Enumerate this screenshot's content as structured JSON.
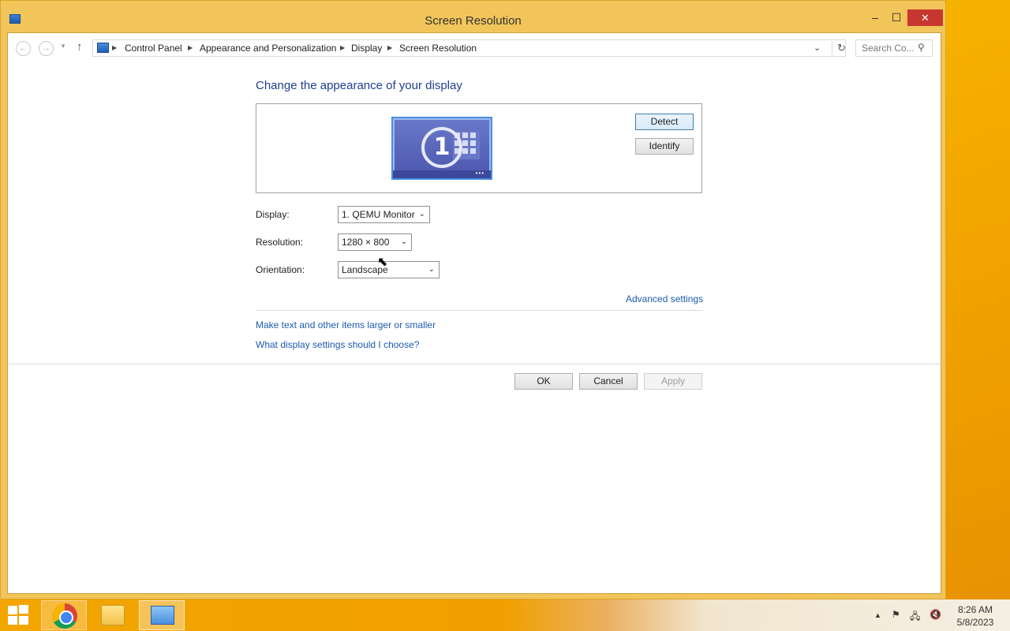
{
  "window": {
    "title": "Screen Resolution",
    "min_glyph": "–",
    "max_glyph": "☐",
    "close_glyph": "✕"
  },
  "nav": {
    "back_glyph": "←",
    "forward_glyph": "→",
    "recent_glyph": "▼",
    "up_glyph": "↑",
    "breadcrumbs": [
      "Control Panel",
      "Appearance and Personalization",
      "Display",
      "Screen Resolution"
    ],
    "crumb_sep": "▶",
    "dropdown_glyph": "⌄",
    "refresh_glyph": "↻",
    "search_placeholder": "Search Co...",
    "search_glyph": "⚲"
  },
  "main": {
    "heading": "Change the appearance of your display",
    "monitor_number": "1",
    "monitor_dots": "•••",
    "detect_label": "Detect",
    "identify_label": "Identify",
    "display_label": "Display:",
    "display_value": "1. QEMU Monitor",
    "resolution_label": "Resolution:",
    "resolution_value": "1280 × 800",
    "orientation_label": "Orientation:",
    "orientation_value": "Landscape",
    "select_glyph": "⌄",
    "advanced_link": "Advanced settings",
    "text_size_link": "Make text and other items larger or smaller",
    "help_link": "What display settings should I choose?",
    "ok_label": "OK",
    "cancel_label": "Cancel",
    "apply_label": "Apply",
    "cursor_glyph": "⬉"
  },
  "taskbar": {
    "tray_up_glyph": "▲",
    "tray_flag_glyph": "⚑",
    "tray_network_glyph": "🖧",
    "tray_volume_glyph": "🔇",
    "time": "8:26 AM",
    "date": "5/8/2023"
  },
  "colors": {
    "accent": "#f2a900",
    "link": "#1e5bb0",
    "heading": "#1e3f8f",
    "close_button": "#c7372f"
  }
}
